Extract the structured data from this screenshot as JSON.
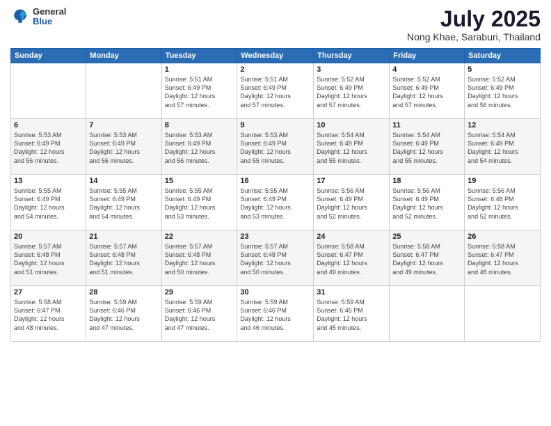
{
  "logo": {
    "general": "General",
    "blue": "Blue"
  },
  "header": {
    "month": "July 2025",
    "location": "Nong Khae, Saraburi, Thailand"
  },
  "weekdays": [
    "Sunday",
    "Monday",
    "Tuesday",
    "Wednesday",
    "Thursday",
    "Friday",
    "Saturday"
  ],
  "weeks": [
    [
      {
        "day": "",
        "info": ""
      },
      {
        "day": "",
        "info": ""
      },
      {
        "day": "1",
        "info": "Sunrise: 5:51 AM\nSunset: 6:49 PM\nDaylight: 12 hours\nand 57 minutes."
      },
      {
        "day": "2",
        "info": "Sunrise: 5:51 AM\nSunset: 6:49 PM\nDaylight: 12 hours\nand 57 minutes."
      },
      {
        "day": "3",
        "info": "Sunrise: 5:52 AM\nSunset: 6:49 PM\nDaylight: 12 hours\nand 57 minutes."
      },
      {
        "day": "4",
        "info": "Sunrise: 5:52 AM\nSunset: 6:49 PM\nDaylight: 12 hours\nand 57 minutes."
      },
      {
        "day": "5",
        "info": "Sunrise: 5:52 AM\nSunset: 6:49 PM\nDaylight: 12 hours\nand 56 minutes."
      }
    ],
    [
      {
        "day": "6",
        "info": "Sunrise: 5:53 AM\nSunset: 6:49 PM\nDaylight: 12 hours\nand 56 minutes."
      },
      {
        "day": "7",
        "info": "Sunrise: 5:53 AM\nSunset: 6:49 PM\nDaylight: 12 hours\nand 56 minutes."
      },
      {
        "day": "8",
        "info": "Sunrise: 5:53 AM\nSunset: 6:49 PM\nDaylight: 12 hours\nand 56 minutes."
      },
      {
        "day": "9",
        "info": "Sunrise: 5:53 AM\nSunset: 6:49 PM\nDaylight: 12 hours\nand 55 minutes."
      },
      {
        "day": "10",
        "info": "Sunrise: 5:54 AM\nSunset: 6:49 PM\nDaylight: 12 hours\nand 55 minutes."
      },
      {
        "day": "11",
        "info": "Sunrise: 5:54 AM\nSunset: 6:49 PM\nDaylight: 12 hours\nand 55 minutes."
      },
      {
        "day": "12",
        "info": "Sunrise: 5:54 AM\nSunset: 6:49 PM\nDaylight: 12 hours\nand 54 minutes."
      }
    ],
    [
      {
        "day": "13",
        "info": "Sunrise: 5:55 AM\nSunset: 6:49 PM\nDaylight: 12 hours\nand 54 minutes."
      },
      {
        "day": "14",
        "info": "Sunrise: 5:55 AM\nSunset: 6:49 PM\nDaylight: 12 hours\nand 54 minutes."
      },
      {
        "day": "15",
        "info": "Sunrise: 5:55 AM\nSunset: 6:49 PM\nDaylight: 12 hours\nand 53 minutes."
      },
      {
        "day": "16",
        "info": "Sunrise: 5:55 AM\nSunset: 6:49 PM\nDaylight: 12 hours\nand 53 minutes."
      },
      {
        "day": "17",
        "info": "Sunrise: 5:56 AM\nSunset: 6:49 PM\nDaylight: 12 hours\nand 52 minutes."
      },
      {
        "day": "18",
        "info": "Sunrise: 5:56 AM\nSunset: 6:49 PM\nDaylight: 12 hours\nand 52 minutes."
      },
      {
        "day": "19",
        "info": "Sunrise: 5:56 AM\nSunset: 6:48 PM\nDaylight: 12 hours\nand 52 minutes."
      }
    ],
    [
      {
        "day": "20",
        "info": "Sunrise: 5:57 AM\nSunset: 6:48 PM\nDaylight: 12 hours\nand 51 minutes."
      },
      {
        "day": "21",
        "info": "Sunrise: 5:57 AM\nSunset: 6:48 PM\nDaylight: 12 hours\nand 51 minutes."
      },
      {
        "day": "22",
        "info": "Sunrise: 5:57 AM\nSunset: 6:48 PM\nDaylight: 12 hours\nand 50 minutes."
      },
      {
        "day": "23",
        "info": "Sunrise: 5:57 AM\nSunset: 6:48 PM\nDaylight: 12 hours\nand 50 minutes."
      },
      {
        "day": "24",
        "info": "Sunrise: 5:58 AM\nSunset: 6:47 PM\nDaylight: 12 hours\nand 49 minutes."
      },
      {
        "day": "25",
        "info": "Sunrise: 5:58 AM\nSunset: 6:47 PM\nDaylight: 12 hours\nand 49 minutes."
      },
      {
        "day": "26",
        "info": "Sunrise: 5:58 AM\nSunset: 6:47 PM\nDaylight: 12 hours\nand 48 minutes."
      }
    ],
    [
      {
        "day": "27",
        "info": "Sunrise: 5:58 AM\nSunset: 6:47 PM\nDaylight: 12 hours\nand 48 minutes."
      },
      {
        "day": "28",
        "info": "Sunrise: 5:59 AM\nSunset: 6:46 PM\nDaylight: 12 hours\nand 47 minutes."
      },
      {
        "day": "29",
        "info": "Sunrise: 5:59 AM\nSunset: 6:46 PM\nDaylight: 12 hours\nand 47 minutes."
      },
      {
        "day": "30",
        "info": "Sunrise: 5:59 AM\nSunset: 6:46 PM\nDaylight: 12 hours\nand 46 minutes."
      },
      {
        "day": "31",
        "info": "Sunrise: 5:59 AM\nSunset: 6:45 PM\nDaylight: 12 hours\nand 45 minutes."
      },
      {
        "day": "",
        "info": ""
      },
      {
        "day": "",
        "info": ""
      }
    ]
  ]
}
